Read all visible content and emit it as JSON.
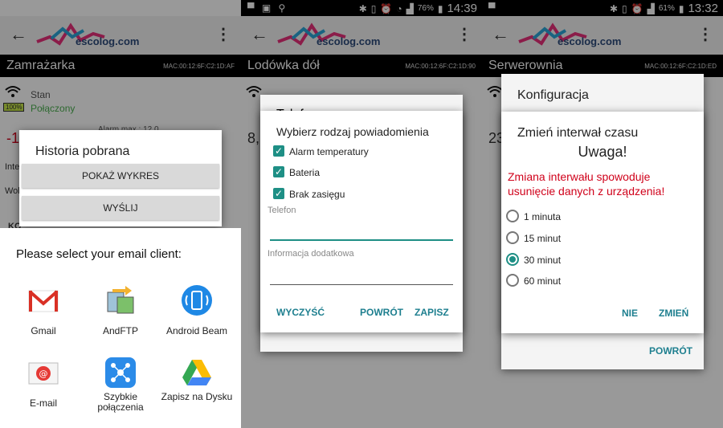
{
  "logo_text": "escolog.com",
  "panel1": {
    "device_title": "Zamrażarka",
    "mac": "MAC:00:12:6F:C2:1D:AF",
    "status_label": "Stan",
    "status_value": "Połączony",
    "battery": "100%",
    "bg_value": "-1",
    "bg_alarm": "Alarm max.: 12.0",
    "bg_row1": "Inte",
    "bg_row2": "Wol",
    "bg_row3": "KO",
    "dialog_title": "Historia pobrana",
    "show_chart_button": "POKAŻ WYKRES",
    "send_button": "WYŚLIJ",
    "sheet_title": "Please select your email client:",
    "apps": [
      {
        "label": "Gmail"
      },
      {
        "label": "AndFTP"
      },
      {
        "label": "Android Beam"
      },
      {
        "label": "E-mail"
      },
      {
        "label": "Szybkie połączenia"
      },
      {
        "label": "Zapisz na Dysku"
      }
    ]
  },
  "panel2": {
    "status_battery": "76%",
    "status_time": "14:39",
    "device_title": "Lodówka dół",
    "mac": "MAC:00:12:6F:C2:1D:90",
    "bg_value": "8,",
    "bg_title": "Telef",
    "dialog_title": "Wybierz rodzaj powiadomienia",
    "checkboxes": [
      "Alarm temperatury",
      "Bateria",
      "Brak zasięgu"
    ],
    "phone_label": "Telefon",
    "phone_value": "",
    "info_label": "Informacja dodatkowa",
    "info_value": "",
    "clear_button": "WYCZYŚĆ",
    "back_button": "POWRÓT",
    "save_button": "ZAPISZ"
  },
  "panel3": {
    "status_battery": "61%",
    "status_time": "13:32",
    "device_title": "Serwerownia",
    "mac": "MAC:00:12:6F:C2:1D:ED",
    "bg_value": "23",
    "config_title": "Konfiguracja",
    "config_back_button": "POWRÓT",
    "dialog_title": "Zmień interwał czasu",
    "warning_title": "Uwaga!",
    "warning_text": "Zmiana interwału spowoduje usunięcie danych z urządzenia!",
    "options": [
      "1 minuta",
      "15 minut",
      "30 minut",
      "60 minut"
    ],
    "selected_option": "30 minut",
    "no_button": "NIE",
    "change_button": "ZMIEŃ"
  },
  "colors": {
    "accent": "#1e8f85",
    "warning": "#d0021b",
    "status_ok": "#4caf50"
  }
}
